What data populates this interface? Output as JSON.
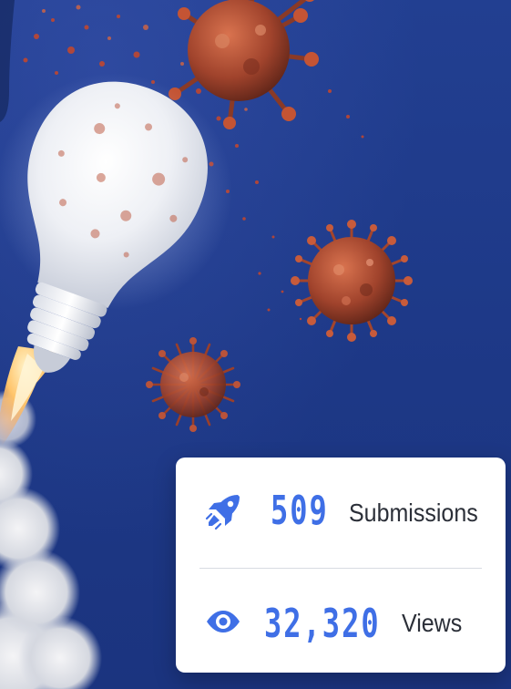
{
  "colors": {
    "background": "#1f3a8a",
    "card": "#ffffff",
    "accent": "#3f6fe6",
    "label_text": "#2b2f38"
  },
  "hero": {
    "icons": [
      "light-bulb-rocket-illustration",
      "coronavirus-illustration"
    ]
  },
  "stats": {
    "submissions": {
      "icon": "rocket-icon",
      "value": "509",
      "label": "Submissions"
    },
    "views": {
      "icon": "eye-icon",
      "value": "32,320",
      "label": "Views"
    }
  }
}
